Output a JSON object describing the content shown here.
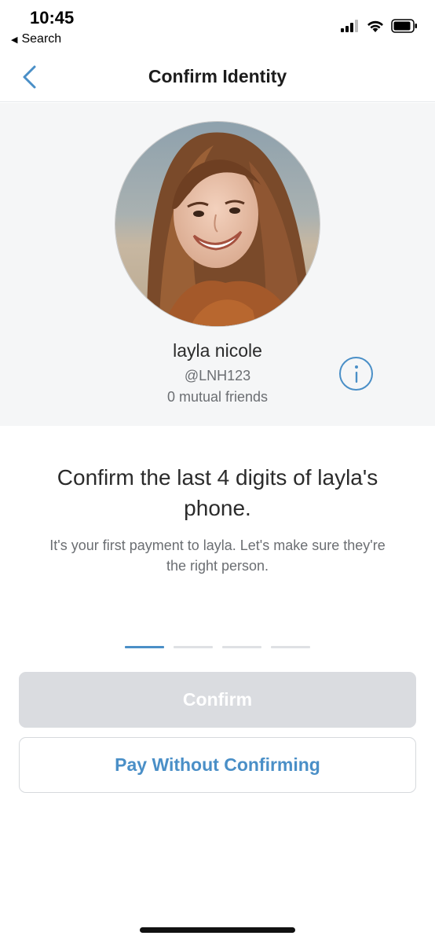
{
  "status_bar": {
    "time": "10:45",
    "back_app_label": "Search",
    "icons": [
      "signal-icon",
      "wifi-icon",
      "battery-icon"
    ]
  },
  "nav": {
    "title": "Confirm Identity",
    "back_icon": "chevron-left-icon"
  },
  "profile": {
    "name": "layla nicole",
    "handle": "@LNH123",
    "mutual_friends": "0 mutual friends",
    "info_icon": "info-icon"
  },
  "prompt": {
    "headline": "Confirm the last 4 digits of layla's phone.",
    "subtext": "It's your first payment to layla. Let's make sure they're the right person."
  },
  "digit_entry": {
    "slots": 4,
    "active_slot": 1
  },
  "actions": {
    "confirm_label": "Confirm",
    "pay_without_label": "Pay Without Confirming"
  },
  "colors": {
    "accent": "#4a8fc7",
    "disabled_button": "#dadce0",
    "profile_background": "#f5f6f7"
  }
}
